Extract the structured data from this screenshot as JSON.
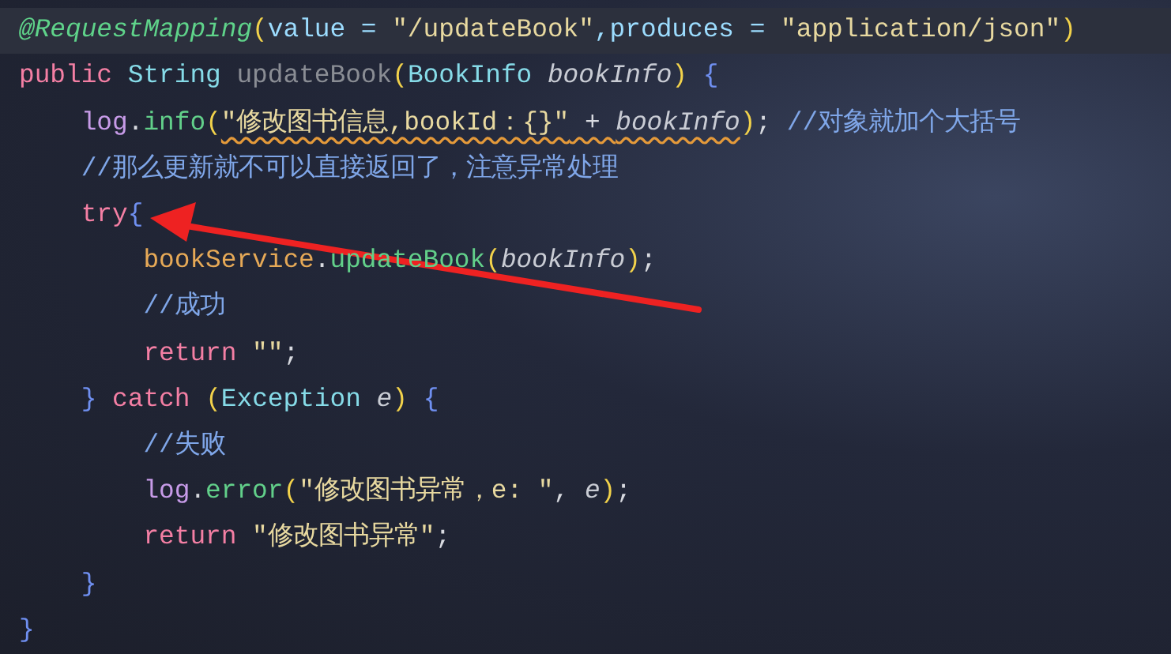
{
  "editor": {
    "lines": [
      {
        "current": true,
        "tokens": [
          {
            "kind": "annotation",
            "text": "@RequestMapping",
            "warn": false
          },
          {
            "kind": "paren",
            "text": "(",
            "warn": false
          },
          {
            "kind": "attr",
            "text": "value = ",
            "warn": false
          },
          {
            "kind": "string",
            "text": "\"/updateBook\"",
            "warn": false
          },
          {
            "kind": "attr",
            "text": ",produces = ",
            "warn": false
          },
          {
            "kind": "string",
            "text": "\"application/json\"",
            "warn": false
          },
          {
            "kind": "paren",
            "text": ")",
            "warn": false
          }
        ]
      },
      {
        "current": false,
        "tokens": [
          {
            "kind": "keyword",
            "text": "public ",
            "warn": false
          },
          {
            "kind": "type",
            "text": "String ",
            "warn": false
          },
          {
            "kind": "unused",
            "text": "updateBook",
            "warn": false
          },
          {
            "kind": "paren",
            "text": "(",
            "warn": false
          },
          {
            "kind": "type",
            "text": "BookInfo ",
            "warn": false
          },
          {
            "kind": "param",
            "text": "bookInfo",
            "warn": false
          },
          {
            "kind": "paren",
            "text": ") ",
            "warn": false
          },
          {
            "kind": "brace",
            "text": "{",
            "warn": false
          }
        ]
      },
      {
        "current": false,
        "tokens": [
          {
            "kind": "field",
            "text": "    log",
            "warn": false
          },
          {
            "kind": "plain",
            "text": ".",
            "warn": false
          },
          {
            "kind": "method",
            "text": "info",
            "warn": false
          },
          {
            "kind": "paren",
            "text": "(",
            "warn": false
          },
          {
            "kind": "string",
            "text": "\"修改图书信息,bookId：{}\"",
            "warn": true
          },
          {
            "kind": "plain",
            "text": " + ",
            "warn": true
          },
          {
            "kind": "param",
            "text": "bookInfo",
            "warn": true
          },
          {
            "kind": "paren",
            "text": ")",
            "warn": false
          },
          {
            "kind": "plain",
            "text": "; ",
            "warn": false
          },
          {
            "kind": "comment",
            "text": "//对象就加个大括号",
            "warn": false
          }
        ]
      },
      {
        "current": false,
        "tokens": [
          {
            "kind": "comment",
            "text": "    //那么更新就不可以直接返回了，注意异常处理",
            "warn": false
          }
        ]
      },
      {
        "current": false,
        "tokens": [
          {
            "kind": "keyword",
            "text": "    try",
            "warn": false
          },
          {
            "kind": "brace",
            "text": "{",
            "warn": false
          }
        ]
      },
      {
        "current": false,
        "tokens": [
          {
            "kind": "field",
            "text": "        bookService",
            "warn": false
          },
          {
            "kind": "plain",
            "text": ".",
            "warn": false
          },
          {
            "kind": "method",
            "text": "updateBook",
            "warn": false
          },
          {
            "kind": "paren",
            "text": "(",
            "warn": false
          },
          {
            "kind": "param",
            "text": "bookInfo",
            "warn": false
          },
          {
            "kind": "paren",
            "text": ")",
            "warn": false
          },
          {
            "kind": "plain",
            "text": ";",
            "warn": false
          }
        ]
      },
      {
        "current": false,
        "tokens": [
          {
            "kind": "comment",
            "text": "        //成功",
            "warn": false
          }
        ]
      },
      {
        "current": false,
        "tokens": [
          {
            "kind": "keyword",
            "text": "        return ",
            "warn": false
          },
          {
            "kind": "string",
            "text": "\"\"",
            "warn": false
          },
          {
            "kind": "plain",
            "text": ";",
            "warn": false
          }
        ]
      },
      {
        "current": false,
        "tokens": [
          {
            "kind": "brace",
            "text": "    } ",
            "warn": false
          },
          {
            "kind": "keyword",
            "text": "catch ",
            "warn": false
          },
          {
            "kind": "paren",
            "text": "(",
            "warn": false
          },
          {
            "kind": "type",
            "text": "Exception ",
            "warn": false
          },
          {
            "kind": "param",
            "text": "e",
            "warn": false
          },
          {
            "kind": "paren",
            "text": ") ",
            "warn": false
          },
          {
            "kind": "brace",
            "text": "{",
            "warn": false
          }
        ]
      },
      {
        "current": false,
        "tokens": [
          {
            "kind": "comment",
            "text": "        //失败",
            "warn": false
          }
        ]
      },
      {
        "current": false,
        "tokens": [
          {
            "kind": "field",
            "text": "        log",
            "warn": false
          },
          {
            "kind": "plain",
            "text": ".",
            "warn": false
          },
          {
            "kind": "method",
            "text": "error",
            "warn": false
          },
          {
            "kind": "paren",
            "text": "(",
            "warn": false
          },
          {
            "kind": "string",
            "text": "\"修改图书异常，e: \"",
            "warn": false
          },
          {
            "kind": "plain",
            "text": ", ",
            "warn": false
          },
          {
            "kind": "param",
            "text": "e",
            "warn": false
          },
          {
            "kind": "paren",
            "text": ")",
            "warn": false
          },
          {
            "kind": "plain",
            "text": ";",
            "warn": false
          }
        ]
      },
      {
        "current": false,
        "tokens": [
          {
            "kind": "keyword",
            "text": "        return ",
            "warn": false
          },
          {
            "kind": "string",
            "text": "\"修改图书异常\"",
            "warn": false
          },
          {
            "kind": "plain",
            "text": ";",
            "warn": false
          }
        ]
      },
      {
        "current": false,
        "tokens": [
          {
            "kind": "brace",
            "text": "    }",
            "warn": false
          }
        ]
      },
      {
        "current": false,
        "tokens": [
          {
            "kind": "brace",
            "text": "}",
            "warn": false
          }
        ]
      }
    ]
  }
}
